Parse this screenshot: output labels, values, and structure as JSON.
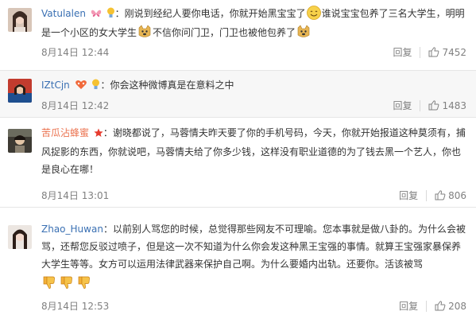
{
  "comments": [
    {
      "username": "Vatulalen",
      "text_a": "刚说到经纪人要你电话，你就开始黑宝宝了",
      "text_b": "谁说宝宝包养了三名大学生，明明是一个小区的女大学生",
      "text_c": "不信你问门卫，门卫也被他包养了",
      "time": "8月14日 12:44",
      "reply_label": "回复",
      "likes": "7452"
    },
    {
      "username": "IZtCjn",
      "text_a": "你会这种微博真是在意料之中",
      "time": "8月14日 12:42",
      "reply_label": "回复",
      "likes": "1483"
    },
    {
      "username": "苦瓜沾蜂蜜",
      "text_a": "谢晓都说了，马蓉情夫昨天要了你的手机号码，今天，你就开始报道这种莫须有，捕风捉影的东西，你就说吧，马蓉情夫给了你多少钱，这样没有职业道德的为了钱去黑一个艺人，你也是良心在哪！",
      "time": "8月14日 13:01",
      "reply_label": "回复",
      "likes": "806"
    },
    {
      "username": "Zhao_Huwan",
      "text_a": "以前别人骂您的时候，总觉得那些网友不可理喻。您本事就是做八卦的。为什么会被骂，还帮您反驳过喷子，但是这一次不知道为什么你会发这种黑王宝强的事情。就算王宝强家暴保养大学生等等。女方可以运用法律武器来保护自己啊。为什么要婚内出轨。还要你。活该被骂",
      "time": "8月14日 12:53",
      "reply_label": "回复",
      "likes": "208"
    }
  ],
  "colors": {
    "username_orange": "#eb7350",
    "username_blue": "#3a70b3",
    "meta_gray": "#808080",
    "text": "#333333"
  },
  "icons": [
    "butterfly-icon",
    "bulb-icon",
    "smile-emoji-icon",
    "doge-emoji-icon",
    "heart-badge-icon",
    "star-icon",
    "thumbs-down-icon",
    "thumbs-up-icon"
  ]
}
